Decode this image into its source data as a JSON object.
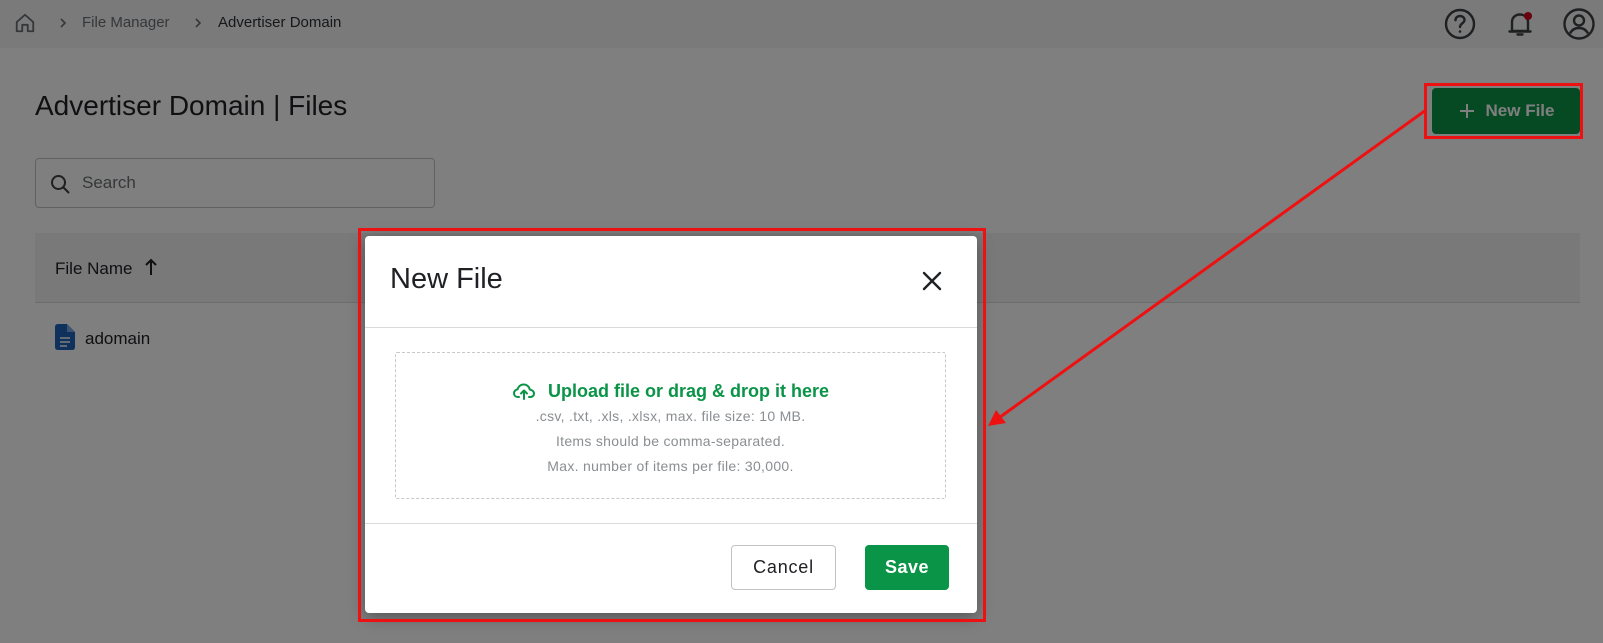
{
  "breadcrumb": {
    "items": [
      {
        "label": "File Manager"
      },
      {
        "label": "Advertiser Domain"
      }
    ]
  },
  "header_icons": [
    "home-icon",
    "help-icon",
    "bell-icon",
    "account-icon"
  ],
  "page": {
    "title": "Advertiser Domain | Files",
    "new_file_button": "New File"
  },
  "search": {
    "placeholder": "Search"
  },
  "table": {
    "columns": [
      {
        "label": "File Name",
        "sort": "ascending"
      }
    ],
    "rows": [
      {
        "name": "adomain",
        "icon": "file-icon"
      }
    ]
  },
  "dialog": {
    "title": "New File",
    "upload_link": "Upload file or drag & drop it here",
    "hints": [
      ".csv, .txt, .xls, .xlsx, max. file size: 10 MB.",
      "Items should be comma-separated.",
      "Max. number of items per file: 30,000."
    ],
    "cancel_label": "Cancel",
    "save_label": "Save"
  },
  "colors": {
    "brand_green": "#0a9447",
    "annotation_red": "#ee1111",
    "notification_dot": "#d0021b"
  }
}
